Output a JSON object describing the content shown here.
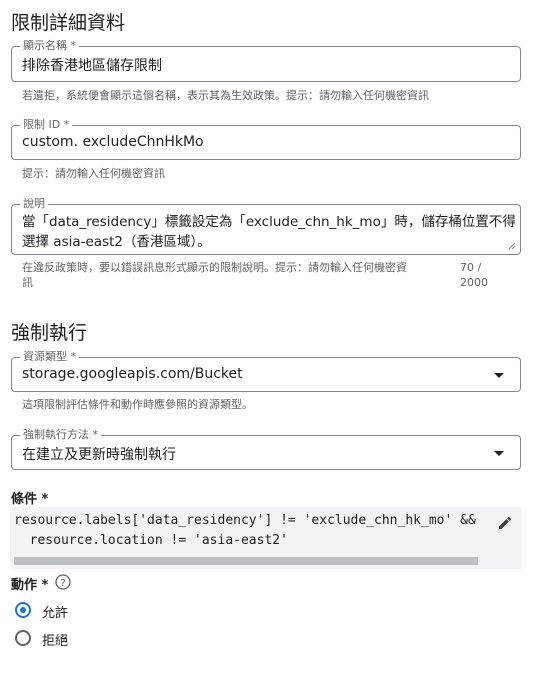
{
  "section1": {
    "title": "限制詳細資料"
  },
  "display_name": {
    "label": "顯示名稱 *",
    "value": "排除香港地區儲存限制",
    "hint": "若遺拒，系統便會顯示這個名稱，表示其為生效政策。提示：請勿輸入任何機密資訊"
  },
  "constraint_id": {
    "label": "限制 ID *",
    "value": "custom. excludeChnHkMo",
    "hint": "提示：請勿輸入任何機密資訊"
  },
  "description": {
    "label": "說明",
    "line1": "當「data_residency」標籤設定為「exclude_chn_hk_mo」時，儲存桶位置不得",
    "line2": "選擇 asia-east2（香港區域）。",
    "hint_line1": "在違反政策時，要以錯誤訊息形式顯示的限制說明。提示：請勿輸入任何機密資",
    "hint_line2": "訊",
    "count_line1": "70 /",
    "count_line2": "2000"
  },
  "section2": {
    "title": "強制執行"
  },
  "resource_type": {
    "label": "資源類型 *",
    "value": "storage.googleapis.com/Bucket",
    "hint": "這項限制評估條件和動作時應參照的資源類型。"
  },
  "enforcement": {
    "label": "強制執行方法 *",
    "value": "在建立及更新時強制執行"
  },
  "condition": {
    "label": "條件 *",
    "line1": "resource.labels['data_residency'] != 'exclude_chn_hk_mo' &&",
    "line2": "  resource.location != 'asia-east2'"
  },
  "action": {
    "label": "動作 *",
    "options": [
      "允許",
      "拒絕"
    ],
    "selected": "允許"
  }
}
